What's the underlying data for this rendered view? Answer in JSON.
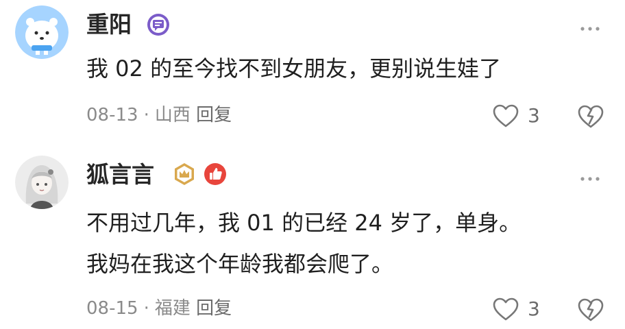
{
  "comments": [
    {
      "username": "重阳",
      "avatar_icon": "polar-bear-avatar",
      "badges": [
        "purple-message-badge-icon"
      ],
      "lines": [
        "我 02 的至今找不到女朋友，更别说生娃了"
      ],
      "date": "08-13",
      "separator": "·",
      "location": "山西",
      "reply_label": "回复",
      "like_count": "3"
    },
    {
      "username": "狐言言",
      "avatar_icon": "anime-girl-avatar",
      "badges": [
        "gold-crown-badge-icon",
        "red-thumb-badge-icon"
      ],
      "lines": [
        "不用过几年，我 01 的已经 24 岁了，单身。",
        "我妈在我这个年龄我都会爬了。"
      ],
      "date": "08-15",
      "separator": "·",
      "location": "福建",
      "reply_label": "回复",
      "like_count": "3"
    }
  ],
  "colors": {
    "text": "#1f1f1f",
    "meta": "#8a8a8a",
    "purple_badge": "#7b5cc9",
    "gold_badge": "#d9a84e",
    "red_badge": "#e8453c",
    "avatar_blue": "#9fd0ff"
  }
}
